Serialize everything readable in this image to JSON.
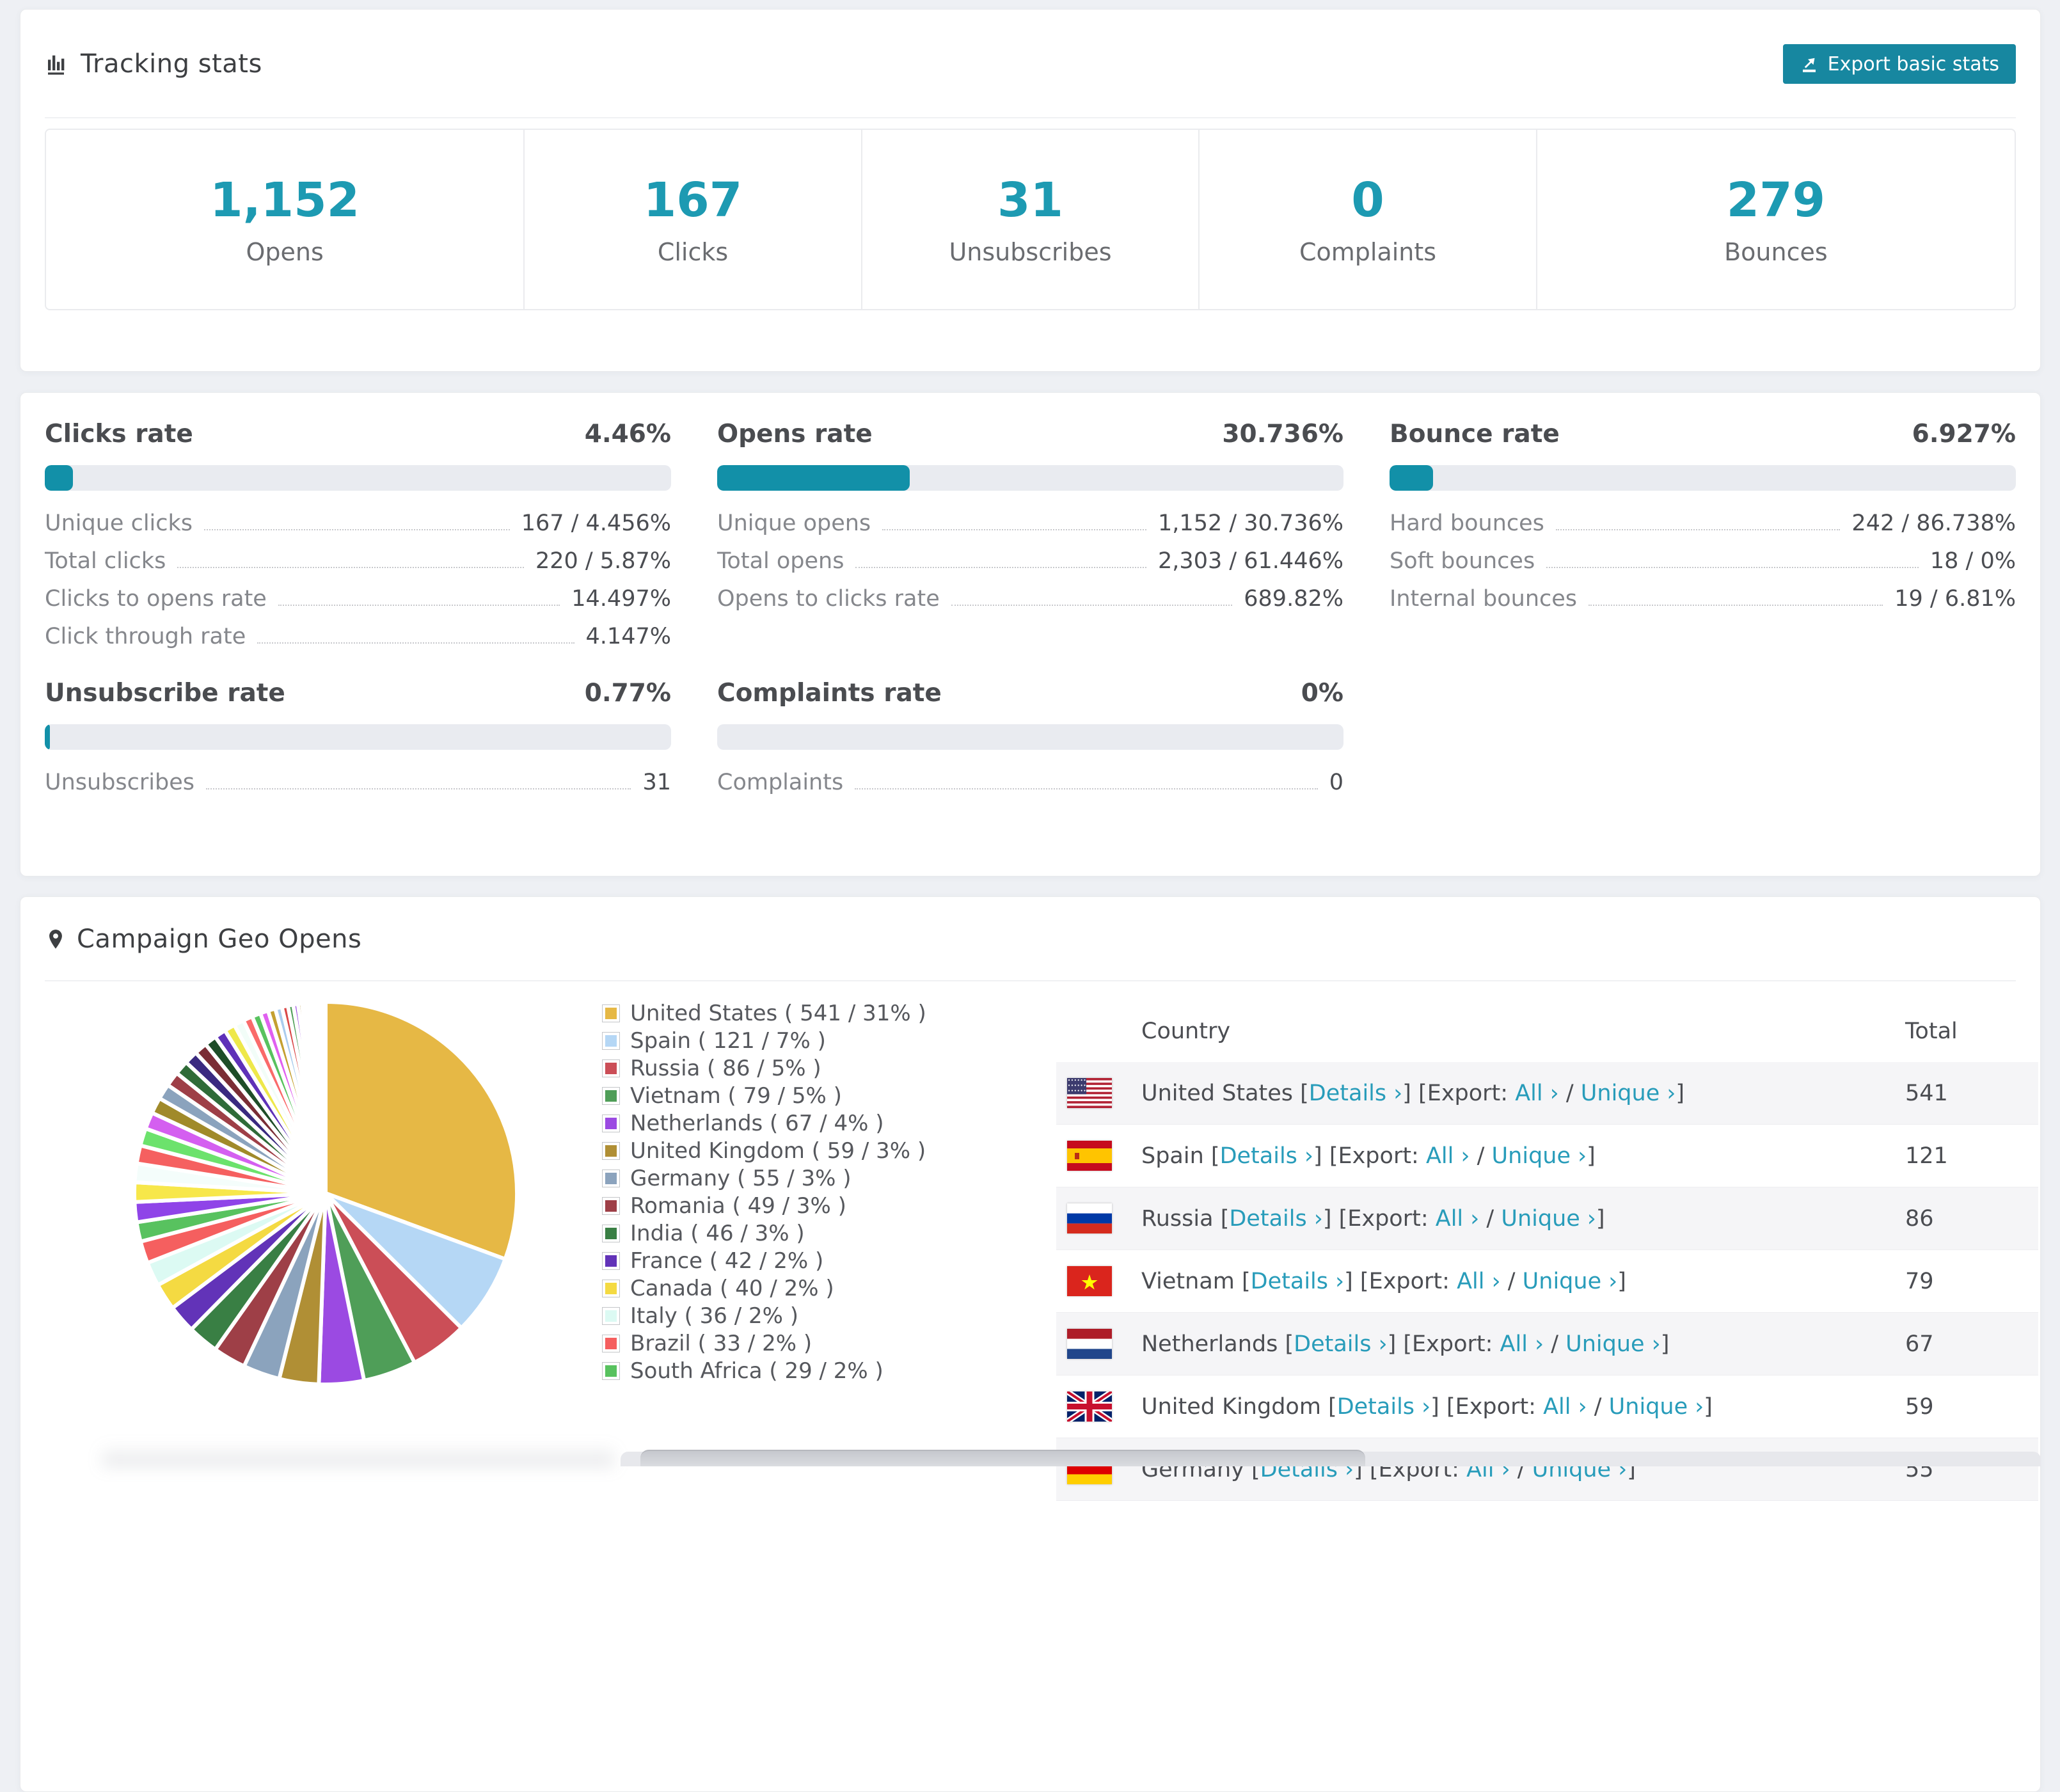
{
  "accent": "#1787a0",
  "tracking": {
    "title": "Tracking stats",
    "export_button": "Export basic stats",
    "stats": [
      {
        "value": "1,152",
        "label": "Opens"
      },
      {
        "value": "167",
        "label": "Clicks"
      },
      {
        "value": "31",
        "label": "Unsubscribes"
      },
      {
        "value": "0",
        "label": "Complaints"
      },
      {
        "value": "279",
        "label": "Bounces"
      }
    ]
  },
  "rates": {
    "sections": [
      {
        "title": "Clicks rate",
        "value": "4.46%",
        "percent": 4.46,
        "rows": [
          {
            "label": "Unique clicks",
            "value": "167 / 4.456%"
          },
          {
            "label": "Total clicks",
            "value": "220 / 5.87%"
          },
          {
            "label": "Clicks to opens rate",
            "value": "14.497%"
          },
          {
            "label": "Click through rate",
            "value": "4.147%"
          }
        ]
      },
      {
        "title": "Opens rate",
        "value": "30.736%",
        "percent": 30.736,
        "rows": [
          {
            "label": "Unique opens",
            "value": "1,152 / 30.736%"
          },
          {
            "label": "Total opens",
            "value": "2,303 / 61.446%"
          },
          {
            "label": "Opens to clicks rate",
            "value": "689.82%"
          }
        ]
      },
      {
        "title": "Bounce rate",
        "value": "6.927%",
        "percent": 6.927,
        "rows": [
          {
            "label": "Hard bounces",
            "value": "242 / 86.738%"
          },
          {
            "label": "Soft bounces",
            "value": "18 / 0%"
          },
          {
            "label": "Internal bounces",
            "value": "19 / 6.81%"
          }
        ]
      },
      {
        "title": "Unsubscribe rate",
        "value": "0.77%",
        "percent": 0.77,
        "rows": [
          {
            "label": "Unsubscribes",
            "value": "31"
          }
        ]
      },
      {
        "title": "Complaints rate",
        "value": "0%",
        "percent": 0,
        "rows": [
          {
            "label": "Complaints",
            "value": "0"
          }
        ]
      }
    ]
  },
  "geo": {
    "title": "Campaign Geo Opens",
    "legend": [
      {
        "color": "#e6b845",
        "label": "United States ( 541 / 31% )"
      },
      {
        "color": "#b5d7f5",
        "label": "Spain ( 121 / 7% )"
      },
      {
        "color": "#cb4e57",
        "label": "Russia ( 86 / 5% )"
      },
      {
        "color": "#4f9e58",
        "label": "Vietnam ( 79 / 5% )"
      },
      {
        "color": "#9b4ae2",
        "label": "Netherlands ( 67 / 4% )"
      },
      {
        "color": "#b08f35",
        "label": "United Kingdom ( 59 / 3% )"
      },
      {
        "color": "#8ba3bd",
        "label": "Germany ( 55 / 3% )"
      },
      {
        "color": "#9e3f47",
        "label": "Romania ( 49 / 3% )"
      },
      {
        "color": "#397f44",
        "label": "India ( 46 / 3% )"
      },
      {
        "color": "#6233b8",
        "label": "France ( 42 / 2% )"
      },
      {
        "color": "#f4da42",
        "label": "Canada ( 40 / 2% )"
      },
      {
        "color": "#dcfaf3",
        "label": "Italy ( 36 / 2% )"
      },
      {
        "color": "#f55f5f",
        "label": "Brazil ( 33 / 2% )"
      },
      {
        "color": "#58c25f",
        "label": "South Africa ( 29 / 2% )"
      }
    ],
    "chart_data": {
      "type": "pie",
      "title": "Campaign Geo Opens",
      "series": [
        {
          "name": "United States",
          "value": 541,
          "pct": "31%",
          "color": "#e6b845"
        },
        {
          "name": "Spain",
          "value": 121,
          "pct": "7%",
          "color": "#b5d7f5"
        },
        {
          "name": "Russia",
          "value": 86,
          "pct": "5%",
          "color": "#cb4e57"
        },
        {
          "name": "Vietnam",
          "value": 79,
          "pct": "5%",
          "color": "#4f9e58"
        },
        {
          "name": "Netherlands",
          "value": 67,
          "pct": "4%",
          "color": "#9b4ae2"
        },
        {
          "name": "United Kingdom",
          "value": 59,
          "pct": "3%",
          "color": "#b08f35"
        },
        {
          "name": "Germany",
          "value": 55,
          "pct": "3%",
          "color": "#8ba3bd"
        },
        {
          "name": "Romania",
          "value": 49,
          "pct": "3%",
          "color": "#9e3f47"
        },
        {
          "name": "India",
          "value": 46,
          "pct": "3%",
          "color": "#397f44"
        },
        {
          "name": "France",
          "value": 42,
          "pct": "2%",
          "color": "#6233b8"
        },
        {
          "name": "Canada",
          "value": 40,
          "pct": "2%",
          "color": "#f4da42"
        },
        {
          "name": "Italy",
          "value": 36,
          "pct": "2%",
          "color": "#dcfaf3"
        },
        {
          "name": "Brazil",
          "value": 33,
          "pct": "2%",
          "color": "#f55f5f"
        },
        {
          "name": "South Africa",
          "value": 29,
          "pct": "2%",
          "color": "#58c25f"
        }
      ],
      "others": [
        {
          "value": 30,
          "color": "#8f44e8"
        },
        {
          "value": 29,
          "color": "#f7e74a"
        },
        {
          "value": 28,
          "color": "#f4fdfb"
        },
        {
          "value": 27,
          "color": "#f56060"
        },
        {
          "value": 26,
          "color": "#6ce26c"
        },
        {
          "value": 25,
          "color": "#d45ff0"
        },
        {
          "value": 24,
          "color": "#a08a2a"
        },
        {
          "value": 23,
          "color": "#8ba3bd"
        },
        {
          "value": 22,
          "color": "#9e3f47"
        },
        {
          "value": 21,
          "color": "#2f6b38"
        },
        {
          "value": 20,
          "color": "#3a2a80"
        },
        {
          "value": 19,
          "color": "#7a2d35"
        },
        {
          "value": 18,
          "color": "#1e4d28"
        },
        {
          "value": 17,
          "color": "#5e31b8"
        },
        {
          "value": 16,
          "color": "#eee84a"
        },
        {
          "value": 15,
          "color": "#f2fdf8"
        },
        {
          "value": 14,
          "color": "#fa6a6a"
        },
        {
          "value": 13,
          "color": "#58c25f"
        },
        {
          "value": 12,
          "color": "#e060f0"
        },
        {
          "value": 11,
          "color": "#c4a030"
        },
        {
          "value": 10,
          "color": "#aaccee"
        },
        {
          "value": 9,
          "color": "#d94848"
        },
        {
          "value": 8,
          "color": "#4f9e58"
        },
        {
          "value": 7,
          "color": "#9b4ae2"
        },
        {
          "value": 6,
          "color": "#b08f35"
        },
        {
          "value": 5,
          "color": "#8ba3bd"
        },
        {
          "value": 5,
          "color": "#9e3f47"
        },
        {
          "value": 4,
          "color": "#397f44"
        },
        {
          "value": 4,
          "color": "#6233b8"
        },
        {
          "value": 3,
          "color": "#f4da42"
        },
        {
          "value": 3,
          "color": "#dcfaf3"
        },
        {
          "value": 2,
          "color": "#f55f5f"
        },
        {
          "value": 2,
          "color": "#58c25f"
        },
        {
          "value": 2,
          "color": "#8f44e8"
        },
        {
          "value": 1,
          "color": "#f7e74a"
        },
        {
          "value": 1,
          "color": "#aaccee"
        },
        {
          "value": 1,
          "color": "#d45ff0"
        },
        {
          "value": 1,
          "color": "#5e31b8"
        },
        {
          "value": 1,
          "color": "#2f6b38"
        }
      ]
    },
    "table": {
      "headers": {
        "country": "Country",
        "total": "Total"
      },
      "links": {
        "open": "[",
        "close": "]",
        "details": "Details ›",
        "export": "Export:",
        "all": "All ›",
        "slash": "/",
        "unique": "Unique ›"
      },
      "rows": [
        {
          "flag": "us",
          "name": "United States",
          "total": "541"
        },
        {
          "flag": "es",
          "name": "Spain",
          "total": "121"
        },
        {
          "flag": "ru",
          "name": "Russia",
          "total": "86"
        },
        {
          "flag": "vn",
          "name": "Vietnam",
          "total": "79"
        },
        {
          "flag": "nl",
          "name": "Netherlands",
          "total": "67"
        },
        {
          "flag": "gb",
          "name": "United Kingdom",
          "total": "59"
        },
        {
          "flag": "de",
          "name": "Germany",
          "total": "55"
        }
      ]
    }
  }
}
